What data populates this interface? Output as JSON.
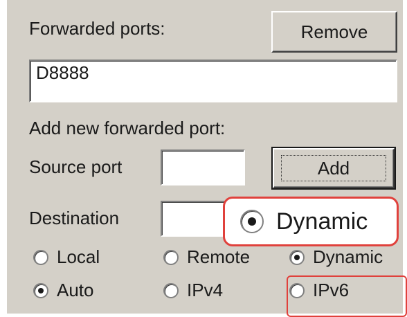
{
  "forwarded_ports": {
    "label": "Forwarded ports:",
    "remove_button": "Remove",
    "entries_value": "D8888"
  },
  "add_section": {
    "heading": "Add new forwarded port:",
    "source_port_label": "Source port",
    "source_port_value": "",
    "add_button": "Add",
    "destination_label": "Destination",
    "destination_value": ""
  },
  "type_radios": {
    "local": "Local",
    "remote": "Remote",
    "dynamic": "Dynamic",
    "selected": "dynamic"
  },
  "ip_radios": {
    "auto": "Auto",
    "ipv4": "IPv4",
    "ipv6": "IPv6",
    "selected": "auto"
  },
  "callout": {
    "label": "Dynamic",
    "color": "#e0413c"
  }
}
